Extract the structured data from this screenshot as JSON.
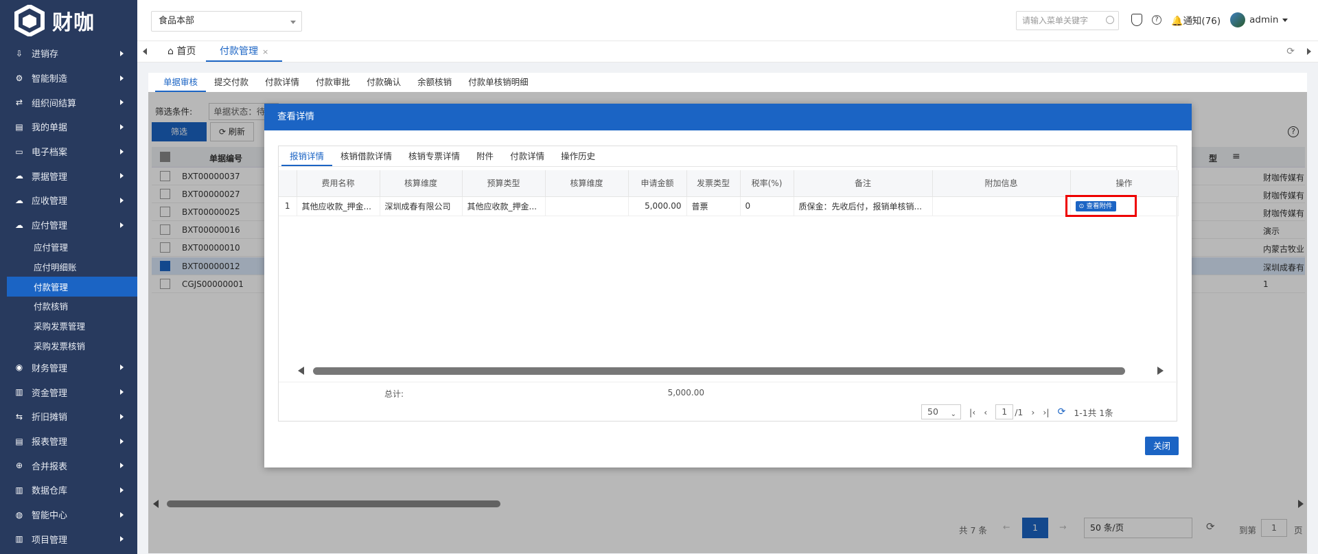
{
  "app": {
    "logo_text": "财咖"
  },
  "sidebar": {
    "items": [
      {
        "label": "进销存",
        "icon": "import-icon"
      },
      {
        "label": "智能制造",
        "icon": "gears-icon"
      },
      {
        "label": "组织间结算",
        "icon": "swap-icon"
      },
      {
        "label": "我的单据",
        "icon": "document-icon"
      },
      {
        "label": "电子档案",
        "icon": "archive-icon"
      },
      {
        "label": "票据管理",
        "icon": "cloud-icon"
      },
      {
        "label": "应收管理",
        "icon": "cloud-icon"
      },
      {
        "label": "应付管理",
        "icon": "cloud-icon"
      }
    ],
    "subitems": [
      "应付管理",
      "应付明细账",
      "付款管理",
      "付款核销",
      "采购发票管理",
      "采购发票核销"
    ],
    "items2": [
      {
        "label": "财务管理",
        "icon": "target-icon"
      },
      {
        "label": "资金管理",
        "icon": "chart-icon"
      },
      {
        "label": "折旧摊销",
        "icon": "cycle-icon"
      },
      {
        "label": "报表管理",
        "icon": "report-icon"
      },
      {
        "label": "合并报表",
        "icon": "merge-icon"
      },
      {
        "label": "数据仓库",
        "icon": "chart-icon"
      },
      {
        "label": "智能中心",
        "icon": "globe-icon"
      },
      {
        "label": "项目管理",
        "icon": "chart-icon"
      }
    ]
  },
  "topbar": {
    "org": "食品本部",
    "search_placeholder": "请输入菜单关键字",
    "notify": "通知(76)",
    "user": "admin"
  },
  "tabs": {
    "home": "首页",
    "active": "付款管理"
  },
  "subtabs": [
    "单据审核",
    "提交付款",
    "付款详情",
    "付款审批",
    "付款确认",
    "余额核销",
    "付款单核销明细"
  ],
  "filter": {
    "label": "筛选条件:",
    "status": "单据状态：待审",
    "filter_btn": "筛选",
    "refresh_btn": "刷新"
  },
  "grid": {
    "col_code": "单据编号",
    "col_type": "型",
    "rows": [
      {
        "code": "BXT00000037",
        "right": "财咖传媒有"
      },
      {
        "code": "BXT00000027",
        "right": "财咖传媒有"
      },
      {
        "code": "BXT00000025",
        "right": "财咖传媒有"
      },
      {
        "code": "BXT00000016",
        "right": "演示"
      },
      {
        "code": "BXT00000010",
        "right": "内蒙古牧业"
      },
      {
        "code": "BXT00000012",
        "right": "深圳成春有"
      },
      {
        "code": "CGJS00000001",
        "right": "1"
      }
    ]
  },
  "pager": {
    "total": "共 7 条",
    "page": "1",
    "page_size": "50 条/页",
    "goto": "到第",
    "goto_page": "1",
    "page_unit": "页"
  },
  "modal": {
    "title": "查看详情",
    "tabs": [
      "报销详情",
      "核销借款详情",
      "核销专票详情",
      "附件",
      "付款详情",
      "操作历史"
    ],
    "columns": [
      "费用名称",
      "核算维度",
      "预算类型",
      "核算维度",
      "申请金额",
      "发票类型",
      "税率(%)",
      "备注",
      "附加信息",
      "操作"
    ],
    "row": {
      "index": "1",
      "fee_name": "其他应收款_押金...",
      "dimension": "深圳成春有限公司",
      "budget_type": "其他应收款_押金...",
      "dimension2": "",
      "amount": "5,000.00",
      "invoice_type": "普票",
      "tax_rate": "0",
      "remark": "质保金：先收后付，报销单核销...",
      "extra": "",
      "action": "查看附件"
    },
    "summary": {
      "label": "总计:",
      "amount": "5,000.00"
    },
    "pager": {
      "size": "50",
      "page": "1",
      "total_pages": "/1",
      "range": "1-1共 1条"
    },
    "close_btn": "关闭"
  }
}
